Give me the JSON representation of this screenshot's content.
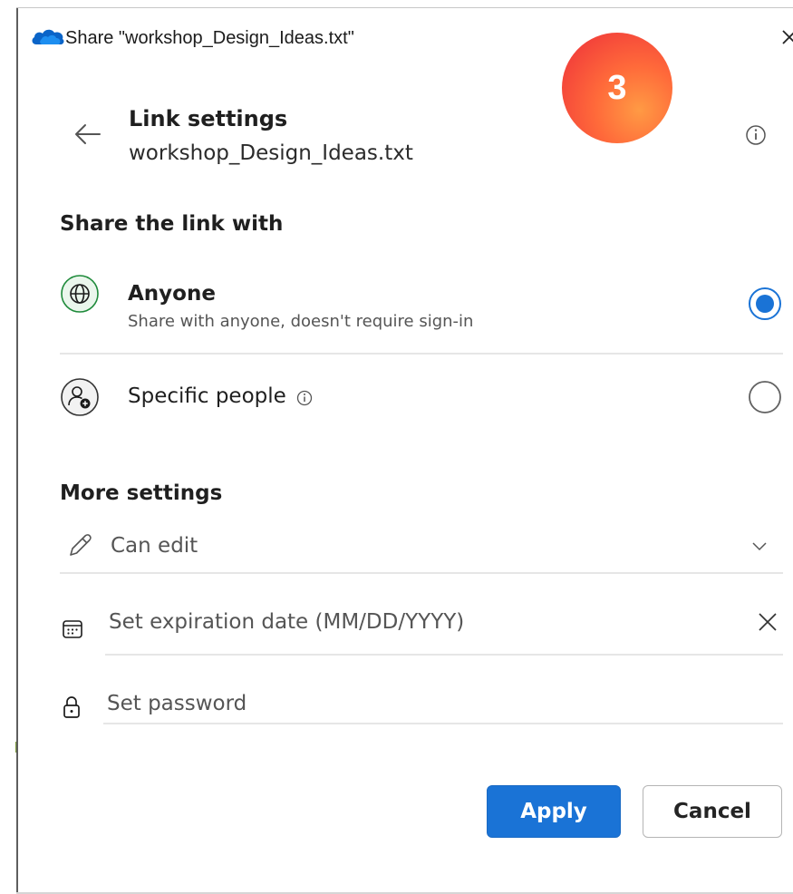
{
  "window": {
    "title": "Share \"workshop_Design_Ideas.txt\"",
    "close_glyph": "✕"
  },
  "badge": {
    "number": "3"
  },
  "header": {
    "title": "Link settings",
    "file_name": "workshop_Design_Ideas.txt"
  },
  "share_section": {
    "heading": "Share the link with",
    "options": [
      {
        "title": "Anyone",
        "subtitle": "Share with anyone, doesn't require sign-in",
        "icon": "globe-icon",
        "selected": true
      },
      {
        "title": "Specific people",
        "icon": "people-icon",
        "selected": false
      }
    ]
  },
  "more_settings": {
    "heading": "More settings",
    "permission": {
      "label": "Can edit",
      "icon": "pencil-icon"
    },
    "expiration": {
      "placeholder": "Set expiration date (MM/DD/YYYY)",
      "icon": "calendar-icon"
    },
    "password": {
      "placeholder": "Set password",
      "icon": "lock-icon"
    }
  },
  "buttons": {
    "apply": "Apply",
    "cancel": "Cancel"
  },
  "colors": {
    "accent": "#1a73d6",
    "globe_green": "#1e8a3a",
    "badge_orange": "#f3423a"
  }
}
